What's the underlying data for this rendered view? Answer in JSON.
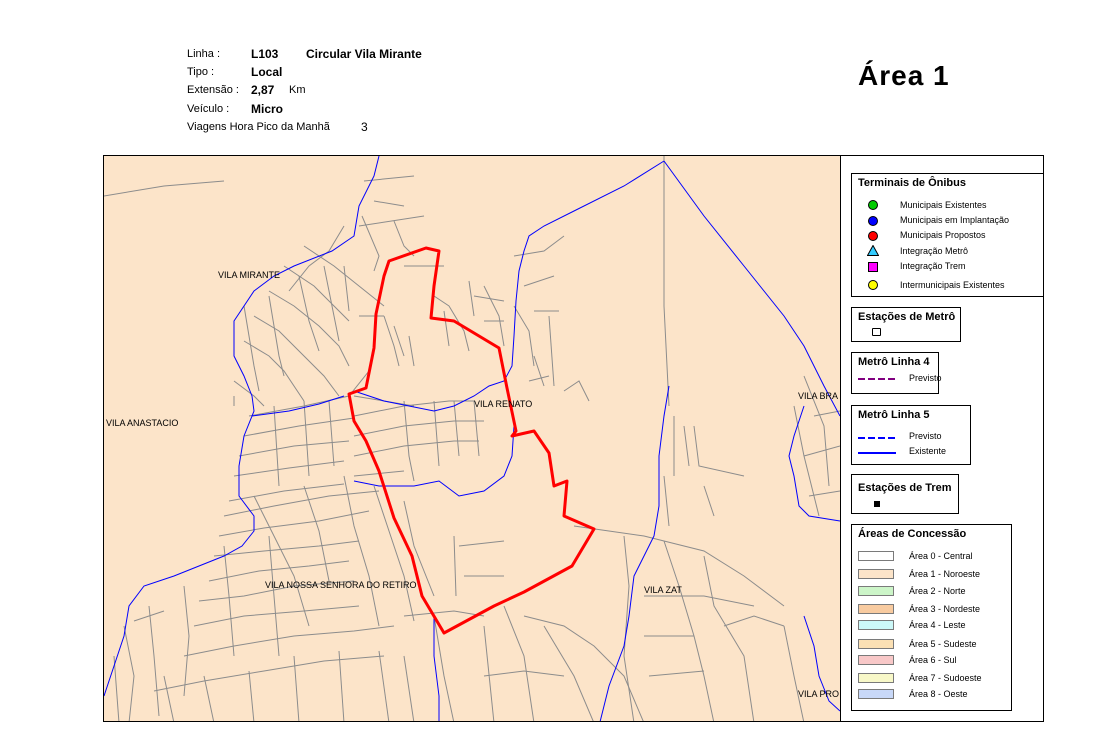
{
  "header": {
    "linha_label": "Linha :",
    "linha_code": "L103",
    "linha_name": "Circular Vila Mirante",
    "tipo_label": "Tipo :",
    "tipo_value": "Local",
    "extensao_label": "Extensão :",
    "extensao_value": "2,87",
    "extensao_unit": "Km",
    "veiculo_label": "Veículo :",
    "veiculo_value": "Micro",
    "viagens_label": "Viagens Hora Pico da Manhã",
    "viagens_value": "3"
  },
  "area_title": "Área  1",
  "map": {
    "labels": {
      "vila_mirante": "VILA MIRANTE",
      "vila_anastacio": "VILA ANASTACIO",
      "vila_renato": "VILA RENATO",
      "vila_nossa_senhora": "VILA NOSSA SENHORA DO RETIRO",
      "vila_zat": "VILA ZAT",
      "vila_bra": "VILA BRA",
      "vila_pro": "VILA PRO"
    },
    "colors": {
      "background": "#fce4c9",
      "streets": "#8c8c8c",
      "boundaries": "#0000ff",
      "route": "#ff0000"
    }
  },
  "legend": {
    "terminais": {
      "title": "Terminais de Ônibus",
      "items": [
        {
          "label": "Municipais Existentes",
          "color": "#00cc00",
          "shape": "circle"
        },
        {
          "label": "Municipais em Implantação",
          "color": "#0000ff",
          "shape": "circle"
        },
        {
          "label": "Municipais Propostos",
          "color": "#ff0000",
          "shape": "circle"
        },
        {
          "label": "Integração Metrô",
          "color": "#33ccff",
          "shape": "triangle"
        },
        {
          "label": "Integração Trem",
          "color": "#ff00ff",
          "shape": "square"
        },
        {
          "label": "Intermunicipais Existentes",
          "color": "#ffff00",
          "shape": "circle"
        }
      ]
    },
    "estacoes_metro": {
      "title": "Estações de Metrô"
    },
    "metro_linha4": {
      "title": "Metrô Linha 4",
      "previsto": "Previsto",
      "color": "#800080"
    },
    "metro_linha5": {
      "title": "Metrô Linha 5",
      "previsto": "Previsto",
      "existente": "Existente",
      "color": "#0000ff"
    },
    "estacoes_trem": {
      "title": "Estações de Trem"
    },
    "areas": {
      "title": "Áreas de Concessão",
      "items": [
        {
          "label": "Área 0 - Central",
          "color": "#ffffff"
        },
        {
          "label": "Área 1 - Noroeste",
          "color": "#fce4c9"
        },
        {
          "label": "Área 2 - Norte",
          "color": "#ccf5c8"
        },
        {
          "label": "Área 3 - Nordeste",
          "color": "#f8cba0"
        },
        {
          "label": "Área 4 - Leste",
          "color": "#ccf8f8"
        },
        {
          "label": "Área 5 - Sudeste",
          "color": "#fbe0b4"
        },
        {
          "label": "Área 6 - Sul",
          "color": "#f8c8c8"
        },
        {
          "label": "Área 7 - Sudoeste",
          "color": "#f8f8c8"
        },
        {
          "label": "Área 8 - Oeste",
          "color": "#c8d8f8"
        }
      ]
    }
  }
}
